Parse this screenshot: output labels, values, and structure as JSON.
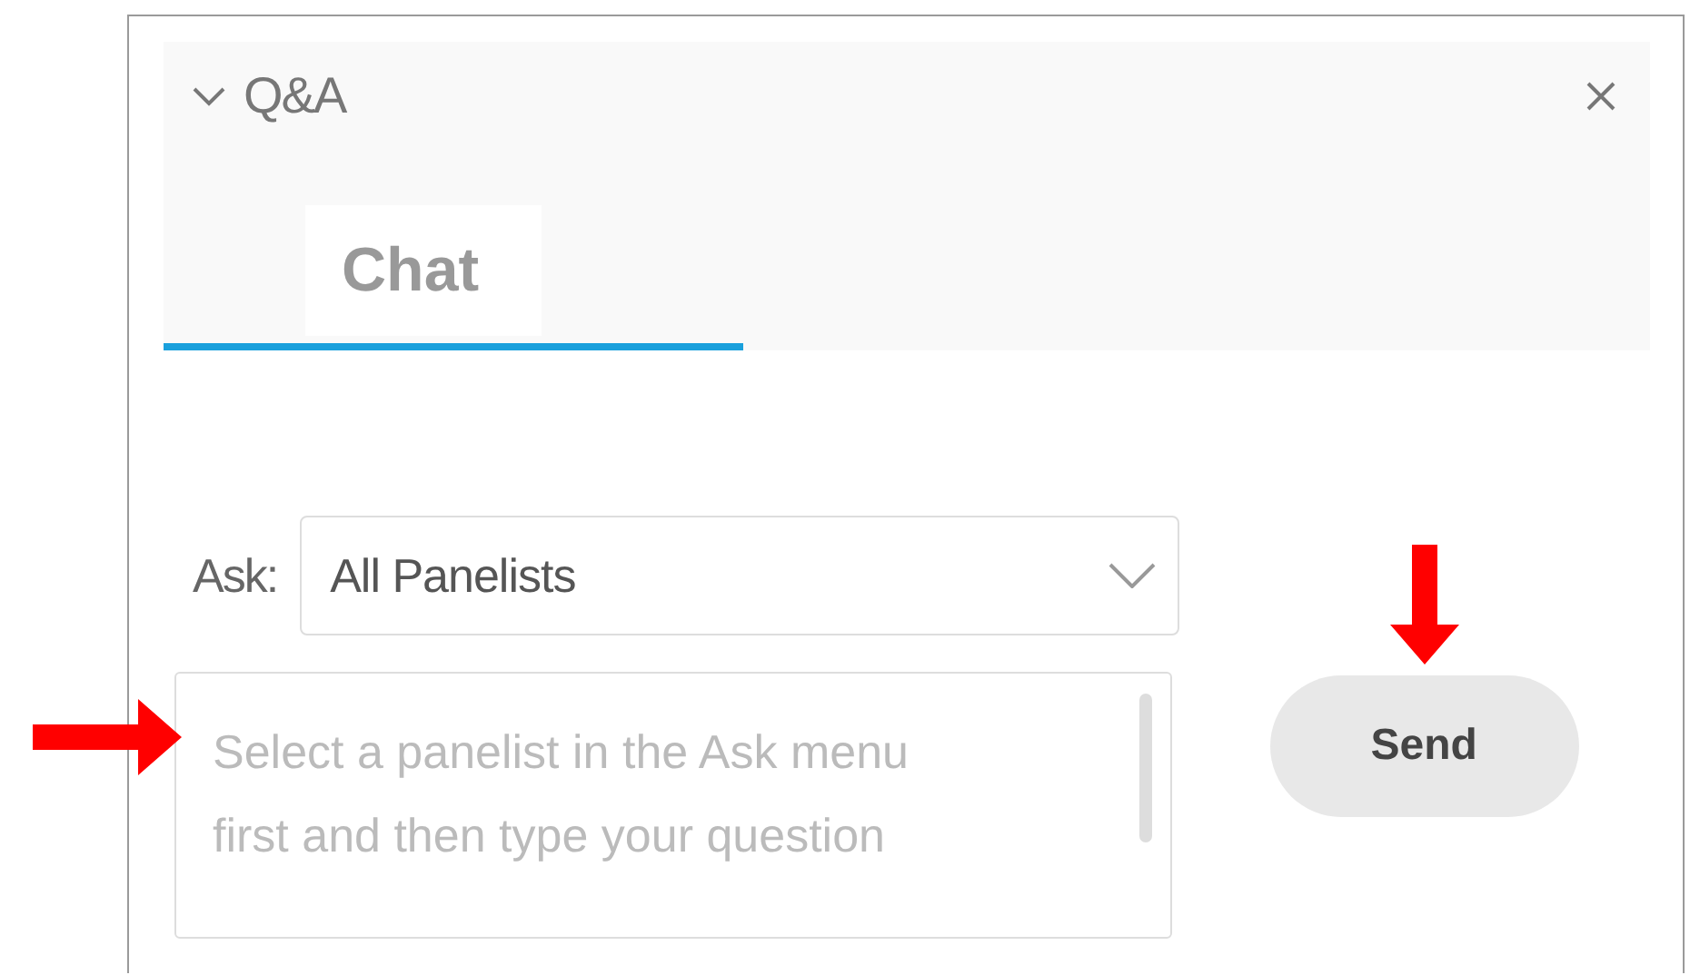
{
  "panel": {
    "title": "Q&A",
    "expanded": true
  },
  "tabs": [
    {
      "label": "Chat",
      "selected": true
    }
  ],
  "ask": {
    "label": "Ask:",
    "value": "All Panelists"
  },
  "question": {
    "placeholder": "Select a panelist in the Ask menu first and then type your question"
  },
  "buttons": [
    {
      "label": "Send"
    }
  ]
}
